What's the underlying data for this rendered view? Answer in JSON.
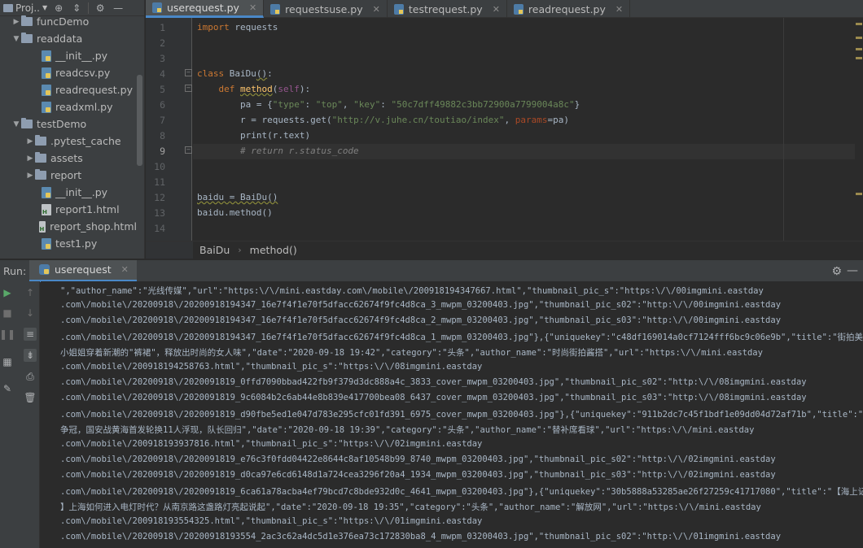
{
  "project": {
    "title": "Proj..",
    "tree": [
      {
        "label": "funcDemo",
        "type": "folder",
        "depth": 1,
        "expanded": false
      },
      {
        "label": "readdata",
        "type": "folder",
        "depth": 1,
        "expanded": true
      },
      {
        "label": "__init__.py",
        "type": "py",
        "depth": 2
      },
      {
        "label": "readcsv.py",
        "type": "py",
        "depth": 2
      },
      {
        "label": "readrequest.py",
        "type": "py",
        "depth": 2
      },
      {
        "label": "readxml.py",
        "type": "py",
        "depth": 2
      },
      {
        "label": "testDemo",
        "type": "folder",
        "depth": 1,
        "expanded": true
      },
      {
        "label": ".pytest_cache",
        "type": "folder",
        "depth": 2,
        "expanded": false
      },
      {
        "label": "assets",
        "type": "folder",
        "depth": 2,
        "expanded": false
      },
      {
        "label": "report",
        "type": "folder",
        "depth": 2,
        "expanded": false
      },
      {
        "label": "__init__.py",
        "type": "py",
        "depth": 2
      },
      {
        "label": "report1.html",
        "type": "html",
        "depth": 2
      },
      {
        "label": "report_shop.html",
        "type": "html",
        "depth": 2
      },
      {
        "label": "test1.py",
        "type": "py",
        "depth": 2
      }
    ]
  },
  "tabs": [
    {
      "label": "userequest.py",
      "active": true
    },
    {
      "label": "requestsuse.py",
      "active": false
    },
    {
      "label": "testrequest.py",
      "active": false
    },
    {
      "label": "readrequest.py",
      "active": false
    }
  ],
  "editor": {
    "line_numbers": [
      "1",
      "2",
      "3",
      "4",
      "5",
      "6",
      "7",
      "8",
      "9",
      "10",
      "11",
      "12",
      "13",
      "14"
    ],
    "code_lines": {
      "l1_kw": "import",
      "l1_rest": " requests",
      "l4_kw": "class",
      "l4_name": "BaiDu",
      "l5_kw": "def",
      "l5_name": "method",
      "l5_self": "self",
      "l6": "pa = {",
      "l6_s1": "\"type\"",
      "l6_s2": "\"top\"",
      "l6_s3": "\"key\"",
      "l6_s4": "\"50c7dff49882c3bb72900a7799004a8c\"",
      "l7_a": "r = requests.get(",
      "l7_url": "\"http://v.juhe.cn/toutiao/index\"",
      "l7_p": "params",
      "l7_b": "=pa)",
      "l8": "print(r.text)",
      "l9": "# return r.status_code",
      "l12": "baidu = BaiDu()",
      "l13": "baidu.method()"
    },
    "breadcrumb": [
      "BaiDu",
      "method()"
    ]
  },
  "run": {
    "label": "Run:",
    "tab": "userequest",
    "output": [
      "\",\"author_name\":\"光线传媒\",\"url\":\"https:\\/\\/mini.eastday.com\\/mobile\\/200918194347667.html\",\"thumbnail_pic_s\":\"https:\\/\\/00imgmini.eastday",
      ".com\\/mobile\\/20200918\\/20200918194347_16e7f4f1e70f5dfacc62674f9fc4d8ca_3_mwpm_03200403.jpg\",\"thumbnail_pic_s02\":\"http:\\/\\/00imgmini.eastday",
      ".com\\/mobile\\/20200918\\/20200918194347_16e7f4f1e70f5dfacc62674f9fc4d8ca_2_mwpm_03200403.jpg\",\"thumbnail_pic_s03\":\"http:\\/\\/00imgmini.eastday",
      ".com\\/mobile\\/20200918\\/20200918194347_16e7f4f1e70f5dfacc62674f9fc4d8ca_1_mwpm_03200403.jpg\"},{\"uniquekey\":\"c48df169014a0cf7124fff6bc9c06e9b\",\"title\":\"街拍美女:",
      "小姐姐穿着新潮的\"裤裙\"，释放出时尚的女人味\",\"date\":\"2020-09-18 19:42\",\"category\":\"头条\",\"author_name\":\"时尚街拍酱搭\",\"url\":\"https:\\/\\/mini.eastday",
      ".com\\/mobile\\/200918194258763.html\",\"thumbnail_pic_s\":\"https:\\/\\/08imgmini.eastday",
      ".com\\/mobile\\/20200918\\/2020091819_0ffd7090bbad422fb9f379d3dc888a4c_3833_cover_mwpm_03200403.jpg\",\"thumbnail_pic_s02\":\"http:\\/\\/08imgmini.eastday",
      ".com\\/mobile\\/20200918\\/2020091819_9c6084b2c6ab44e8b839e417700bea08_6437_cover_mwpm_03200403.jpg\",\"thumbnail_pic_s03\":\"http:\\/\\/08imgmini.eastday",
      ".com\\/mobile\\/20200918\\/2020091819_d90fbe5ed1e047d783e295cfc01fd391_6975_cover_mwpm_03200403.jpg\"},{\"uniquekey\":\"911b2dc7c45f1bdf1e09dd04d72af71b\",\"title\":\"双线",
      "争冠，国安战黄海首发轮换11人浮现，队长回归\",\"date\":\"2020-09-18 19:39\",\"category\":\"头条\",\"author_name\":\"替补席看球\",\"url\":\"https:\\/\\/mini.eastday",
      ".com\\/mobile\\/200918193937816.html\",\"thumbnail_pic_s\":\"https:\\/\\/02imgmini.eastday",
      ".com\\/mobile\\/20200918\\/2020091819_e76c3f0fdd04422e8644c8af10548b99_8740_mwpm_03200403.jpg\",\"thumbnail_pic_s02\":\"http:\\/\\/02imgmini.eastday",
      ".com\\/mobile\\/20200918\\/2020091819_d0ca97e6cd6148d1a724cea3296f20a4_1934_mwpm_03200403.jpg\",\"thumbnail_pic_s03\":\"http:\\/\\/02imgmini.eastday",
      ".com\\/mobile\\/20200918\\/2020091819_6ca61a78acba4ef79bcd7c8bde932d0c_4641_mwpm_03200403.jpg\"},{\"uniquekey\":\"30b5888a53285ae26f27259c41717080\",\"title\":\"【海上记忆",
      "】上海如何进入电灯时代？从南京路这盏路灯亮起说起\",\"date\":\"2020-09-18 19:35\",\"category\":\"头条\",\"author_name\":\"解放网\",\"url\":\"https:\\/\\/mini.eastday",
      ".com\\/mobile\\/200918193554325.html\",\"thumbnail_pic_s\":\"https:\\/\\/01imgmini.eastday",
      ".com\\/mobile\\/20200918\\/20200918193554_2ac3c62a4dc5d1e376ea73c172830ba8_4_mwpm_03200403.jpg\",\"thumbnail_pic_s02\":\"http:\\/\\/01imgmini.eastday"
    ]
  },
  "colors": {
    "accent": "#4a88c7",
    "keyword": "#cc7832",
    "string": "#6a8759",
    "function": "#ffc66d"
  }
}
